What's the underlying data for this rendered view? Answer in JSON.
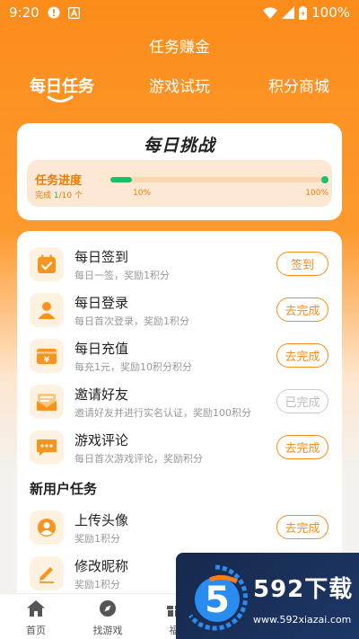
{
  "status_bar": {
    "time": "9:20",
    "battery": "100%"
  },
  "header": {
    "title": "任务赚金"
  },
  "tabs": [
    {
      "label": "每日任务",
      "active": true
    },
    {
      "label": "游戏试玩",
      "active": false
    },
    {
      "label": "积分商城",
      "active": false
    }
  ],
  "challenge": {
    "title": "每日挑战",
    "progress_label": "任务进度",
    "completed_prefix": "完成 ",
    "completed_count": "1",
    "completed_suffix": "/10 个",
    "progress_fraction": 0.1,
    "tick_min": "10%",
    "tick_max": "100%"
  },
  "daily_tasks": [
    {
      "title": "每日签到",
      "desc": "每日一签，奖励1积分",
      "button": "签到",
      "icon": "calendar-check-icon",
      "state": "active"
    },
    {
      "title": "每日登录",
      "desc": "每日首次登录，奖励1积分",
      "button": "去完成",
      "icon": "user-icon",
      "state": "active"
    },
    {
      "title": "每日充值",
      "desc": "每充1元，奖励10积分积分",
      "button": "去完成",
      "icon": "wallet-yen-icon",
      "state": "active"
    },
    {
      "title": "邀请好友",
      "desc": "邀请好友并进行实名认证，奖励100积分",
      "button": "已完成",
      "icon": "envelope-icon",
      "state": "done"
    },
    {
      "title": "游戏评论",
      "desc": "每日首次游戏评论，奖励积分",
      "button": "去完成",
      "icon": "comment-icon",
      "state": "active"
    }
  ],
  "new_user_section": {
    "title": "新用户任务"
  },
  "new_user_tasks": [
    {
      "title": "上传头像",
      "desc": "奖励1积分",
      "button": "去完成",
      "icon": "avatar-circle-icon",
      "state": "active"
    },
    {
      "title": "修改昵称",
      "desc": "奖励1积分",
      "button": "",
      "icon": "pencil-icon",
      "state": "active"
    }
  ],
  "bottom_nav": [
    {
      "label": "首页",
      "icon": "home-icon"
    },
    {
      "label": "找游戏",
      "icon": "compass-icon"
    },
    {
      "label": "福",
      "icon": "gift-icon"
    }
  ],
  "watermark": {
    "name": "592下载",
    "url": "www.592xiazai.com",
    "logo_text": "5"
  },
  "colors": {
    "accent": "#fb8c1a",
    "success": "#19c16a",
    "icon_bg": "#fff1e0"
  }
}
